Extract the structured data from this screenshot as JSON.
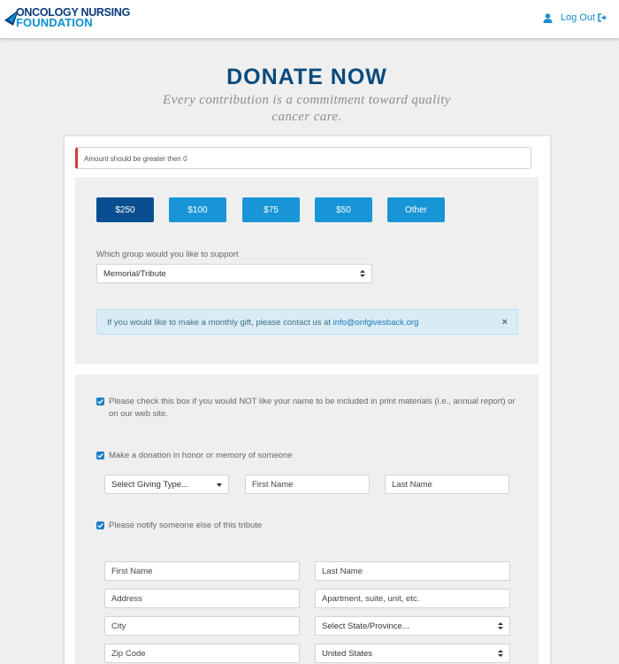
{
  "header": {
    "logo_line1": "ONCOLOGY NURSING",
    "logo_line2": "FOUNDATION",
    "logout_label": "Log Out"
  },
  "page": {
    "title": "DONATE NOW",
    "subtitle": "Every contribution is a commitment toward quality cancer care."
  },
  "alerts": {
    "amount_error": "Amount should be greater then 0",
    "monthly_text": "If you would like to make a monthly gift, please contact us at ",
    "monthly_email": "info@onfgivesback.org",
    "close_symbol": "×"
  },
  "amounts": {
    "options": [
      "$250",
      "$100",
      "$75",
      "$50",
      "Other"
    ],
    "selected": "$250"
  },
  "group": {
    "label": "Which group would you like to support",
    "selected": "Memorial/Tribute"
  },
  "options": {
    "exclude_name": "Please check this box if you would NOT like your name to be included in print materials (i.e., annual report) or on our web site.",
    "honor_memory": "Make a donation in honor or memory of someone",
    "notify_tribute": "Please notify someone else of this tribute"
  },
  "honoree": {
    "giving_type": "Select Giving Type...",
    "first_name_placeholder": "First Name",
    "last_name_placeholder": "Last Name"
  },
  "notify": {
    "first_name_placeholder": "First Name",
    "last_name_placeholder": "Last Name",
    "address_placeholder": "Address",
    "apartment_placeholder": "Apartment, suite, unit, etc.",
    "city_placeholder": "City",
    "state_select": "Select State/Province...",
    "zip_placeholder": "Zip Code",
    "country_select": "United States"
  },
  "colors": {
    "brand_dark": "#0a4a7c",
    "brand_accent": "#1895d6",
    "active_button": "#0a4e92",
    "error_bar": "#d83a3a"
  }
}
